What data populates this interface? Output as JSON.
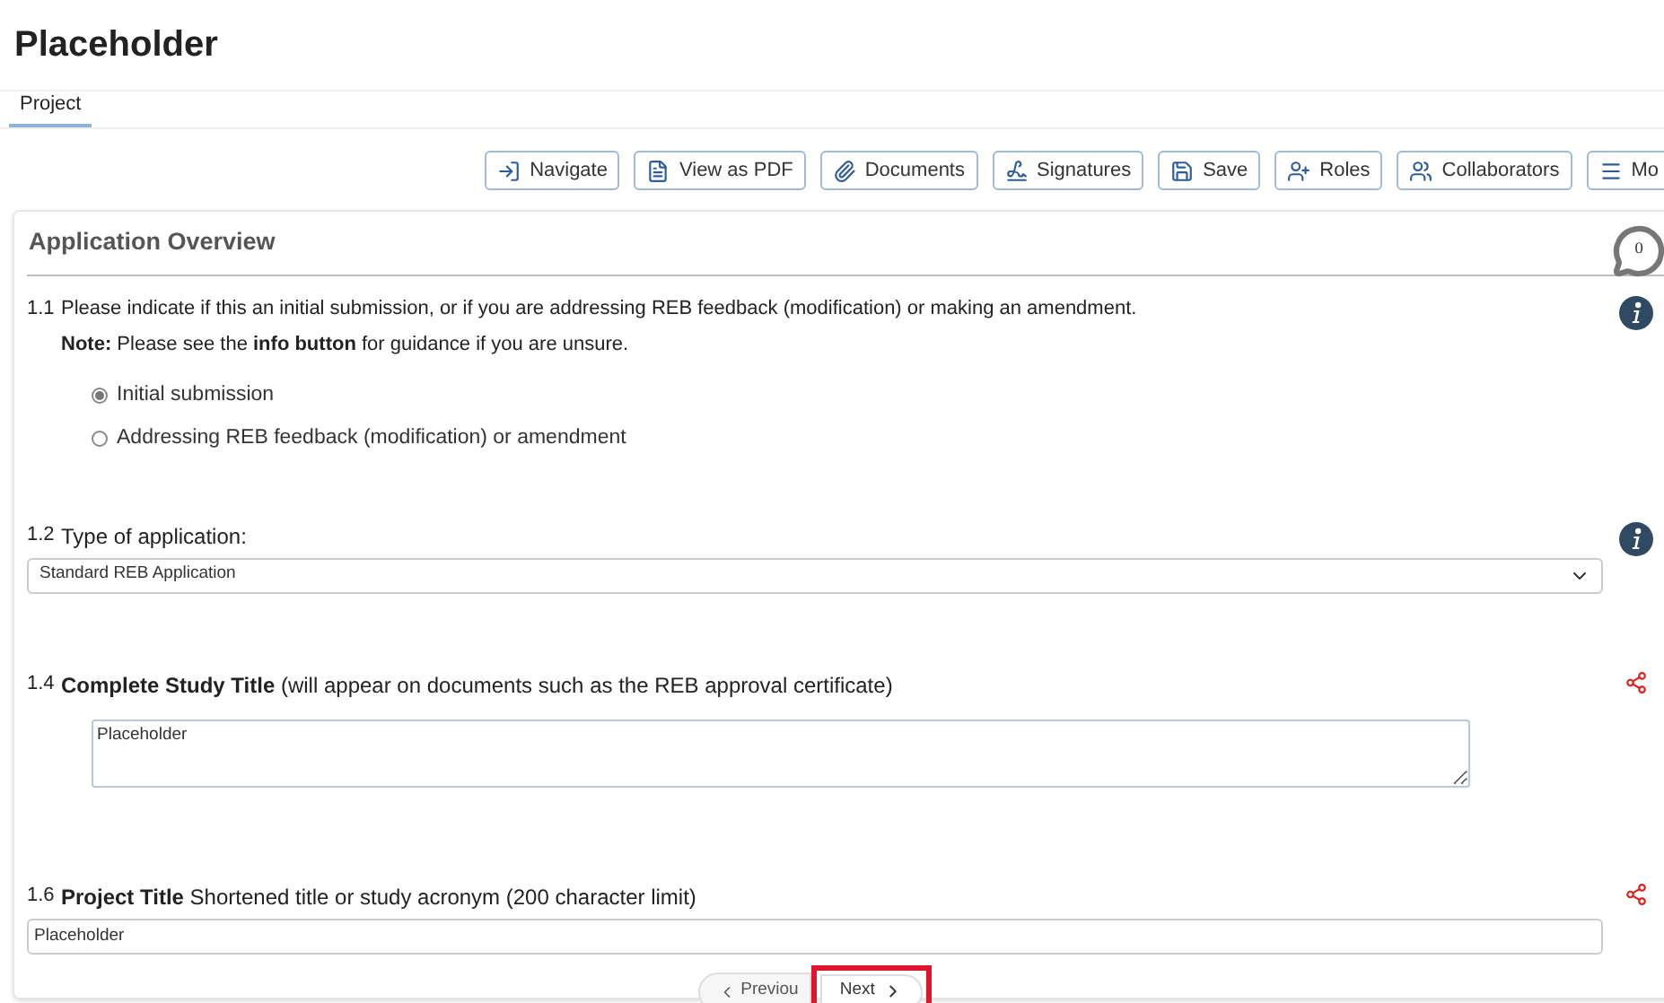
{
  "page_title": "Placeholder",
  "tabs": [
    {
      "label": "Project",
      "selected": true
    }
  ],
  "toolbar": [
    {
      "kind": "navigate",
      "label": "Navigate"
    },
    {
      "kind": "pdf",
      "label": "View as PDF"
    },
    {
      "kind": "documents",
      "label": "Documents"
    },
    {
      "kind": "signatures",
      "label": "Signatures"
    },
    {
      "kind": "save",
      "label": "Save"
    },
    {
      "kind": "roles",
      "label": "Roles"
    },
    {
      "kind": "collaborators",
      "label": "Collaborators"
    },
    {
      "kind": "more",
      "label": "Mo"
    }
  ],
  "section": {
    "title": "Application Overview",
    "comment_count": "0"
  },
  "questions": [
    {
      "kind": "radio",
      "number": "1.1",
      "text": "Please indicate if this an initial submission, or if you are addressing REB feedback (modification) or making an amendment.",
      "note": "**Note:** Please see the **info button** for guidance if you are unsure.",
      "aside": {
        "kind": "info"
      },
      "options": [
        {
          "label": "Initial submission",
          "selected": true
        },
        {
          "label": "Addressing REB feedback (modification) or amendment",
          "selected": false
        }
      ]
    },
    {
      "kind": "select",
      "number": "1.2",
      "text": "Type of application:",
      "aside": {
        "kind": "info"
      },
      "value": "Standard REB Application"
    },
    {
      "kind": "textarea",
      "number": "1.4",
      "text": "**Complete Study Title** (will appear on documents such as the REB approval certificate)",
      "aside": {
        "kind": "share"
      },
      "value": "Placeholder"
    },
    {
      "kind": "input",
      "number": "1.6",
      "text": "**Project Title** Shortened title or study acronym (200 character limit)",
      "aside": {
        "kind": "share"
      },
      "value": "Placeholder"
    }
  ],
  "pager": {
    "previous": "Previou",
    "next": "Next",
    "next_highlighted": true
  }
}
